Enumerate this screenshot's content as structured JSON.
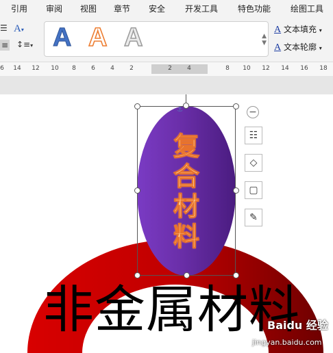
{
  "ribbon_tabs": [
    "引用",
    "审阅",
    "视图",
    "章节",
    "安全",
    "开发工具",
    "特色功能",
    "绘图工具"
  ],
  "text_styles": [
    {
      "label": "A",
      "color": "#4472c4"
    },
    {
      "label": "A",
      "color": "#ed7d31"
    },
    {
      "label": "A",
      "color": "#9a9a9a"
    }
  ],
  "format_buttons": {
    "text_fill": "文本填充",
    "text_outline": "文本轮廓"
  },
  "left_ribbon_icons": [
    "text-direction-icon",
    "font-effects-icon",
    "align-icon",
    "line-spacing-icon"
  ],
  "ruler": {
    "numbers": [
      "6",
      "14",
      "12",
      "10",
      "8",
      "6",
      "4",
      "2",
      "2",
      "4",
      "8",
      "10",
      "12",
      "14",
      "16",
      "18"
    ]
  },
  "shape": {
    "text_chars": [
      "复",
      "合",
      "材",
      "料"
    ],
    "fill_color": "#6a2ea8",
    "text_color": "#ffd29a"
  },
  "side_tools": [
    "layout-options-icon",
    "shape-fill-icon",
    "shape-outline-icon",
    "format-painter-icon"
  ],
  "background_text": "非金属材料",
  "arc_color": "#c00000",
  "watermark": {
    "site_cn": "Baidu 经验",
    "url": "jingyan.baidu.com"
  }
}
